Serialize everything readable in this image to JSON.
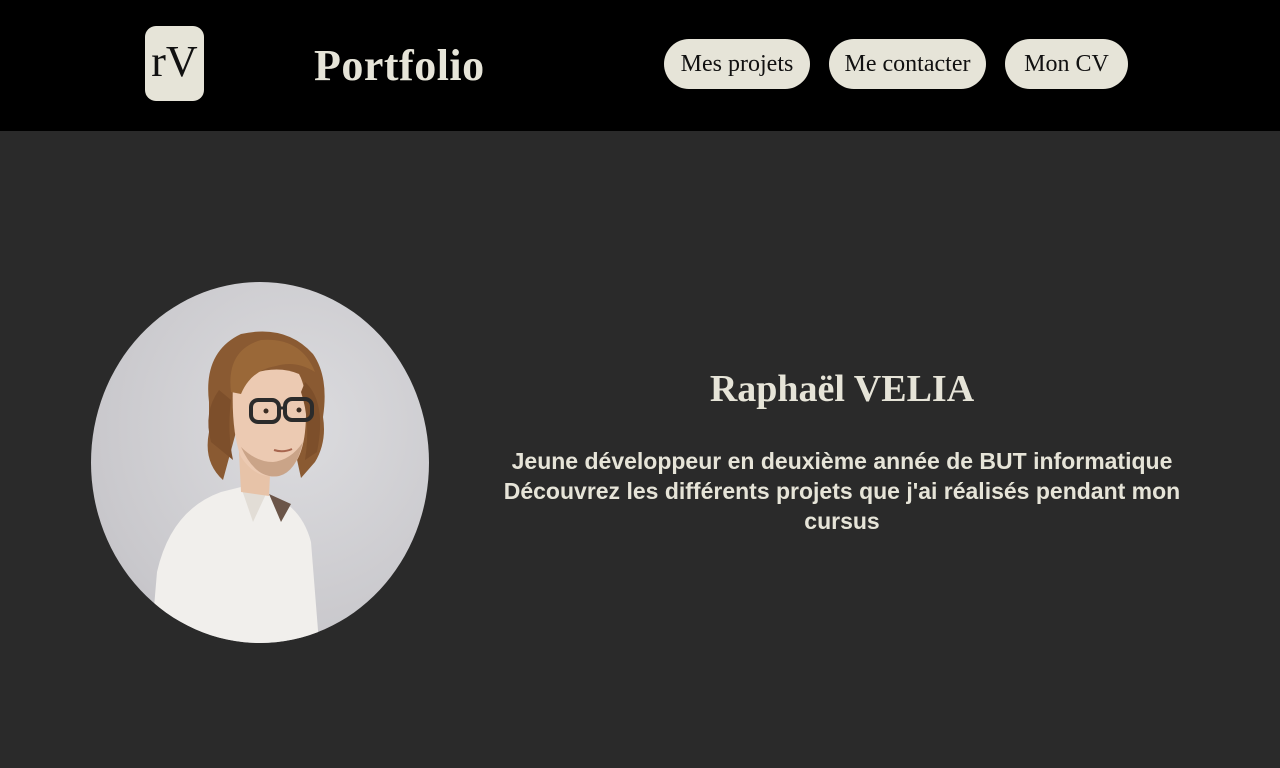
{
  "header": {
    "logo_text": "rV",
    "title": "Portfolio",
    "nav": {
      "projects": "Mes projets",
      "contact": "Me contacter",
      "cv": "Mon CV"
    }
  },
  "hero": {
    "name": "Raphaël VELIA",
    "tagline_line1": "Jeune développeur en deuxième année de BUT informatique",
    "tagline_line2": "Découvrez les différents projets que j'ai réalisés pendant mon cursus"
  },
  "colors": {
    "header_bg": "#000000",
    "page_bg": "#2a2a2a",
    "accent": "#e6e4d8"
  }
}
